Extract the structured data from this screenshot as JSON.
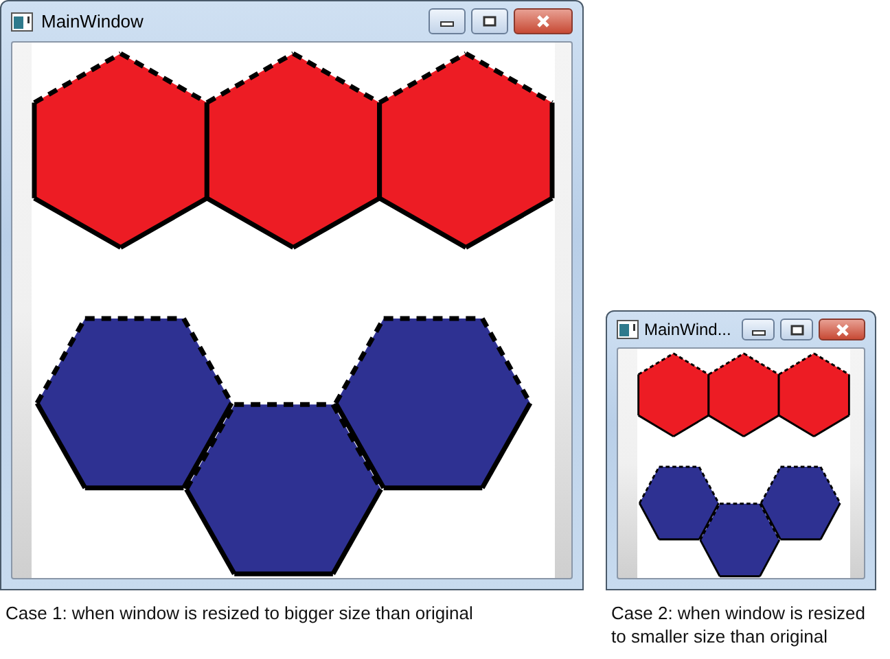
{
  "windows": [
    {
      "title": "MainWindow",
      "caption": "Case 1: when window is resized to bigger size than original",
      "shape_rows": [
        {
          "kind": "straight",
          "color": "#ed1c24"
        },
        {
          "kind": "zigzag",
          "color": "#2e3192"
        }
      ]
    },
    {
      "title": "MainWind...",
      "caption": "Case 2: when window is resized to smaller size than original",
      "shape_rows": [
        {
          "kind": "straight",
          "color": "#ed1c24"
        },
        {
          "kind": "zigzag",
          "color": "#2e3192"
        }
      ]
    }
  ]
}
